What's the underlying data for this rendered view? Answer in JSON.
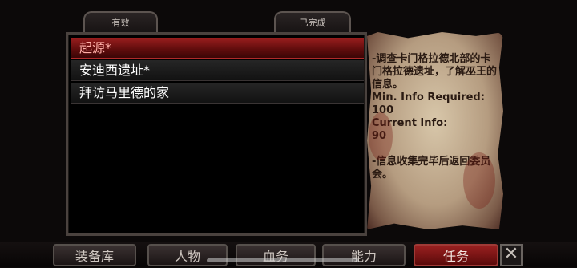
{
  "tabs": {
    "active_label": "有效",
    "completed_label": "已完成"
  },
  "quests": [
    {
      "label": "起源*",
      "selected": true
    },
    {
      "label": "安迪西遗址*",
      "selected": false
    },
    {
      "label": "拜访马里德的家",
      "selected": false
    }
  ],
  "details": {
    "text": "-调查卡门格拉德北部的卡门格拉德遗址，了解巫王的信息。\nMin. Info Required:\n100\nCurrent Info:\n90\n\n-信息收集完毕后返回委员会。"
  },
  "nav": [
    {
      "label": "装备库",
      "active": false
    },
    {
      "label": "人物",
      "active": false
    },
    {
      "label": "血务",
      "active": false
    },
    {
      "label": "能力",
      "active": false
    },
    {
      "label": "任务",
      "active": true
    }
  ],
  "close_icon": "✕",
  "colors": {
    "selected_red": "#8a1414",
    "parchment": "#c9b596"
  }
}
